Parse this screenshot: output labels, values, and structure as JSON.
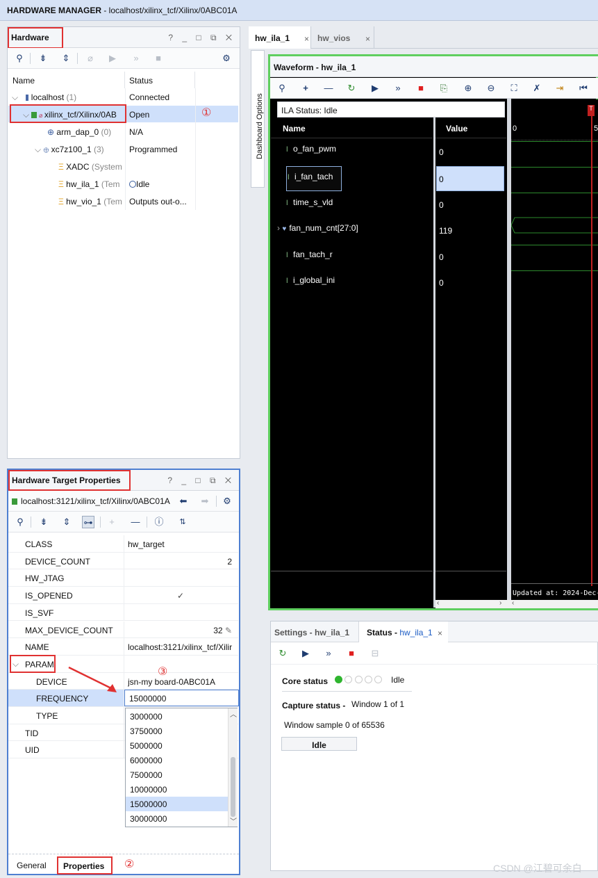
{
  "titlebar": {
    "app": "HARDWARE MANAGER",
    "path": " - localhost/xilinx_tcf/Xilinx/0ABC01A"
  },
  "hardware": {
    "title": "Hardware",
    "window_controls": "? _ □ ⧉ ✕",
    "columns": [
      "Name",
      "Status"
    ],
    "rows": [
      {
        "name": "localhost",
        "count": "(1)",
        "status": "Connected"
      },
      {
        "name": "xilinx_tcf/Xilinx/0AB",
        "count": "",
        "status": "Open"
      },
      {
        "name": "arm_dap_0",
        "count": "(0)",
        "status": "N/A"
      },
      {
        "name": "xc7z100_1",
        "count": "(3)",
        "status": "Programmed"
      },
      {
        "name": "XADC",
        "count": "(System",
        "status": ""
      },
      {
        "name": "hw_ila_1",
        "count": "(Tem",
        "status": "Idle"
      },
      {
        "name": "hw_vio_1",
        "count": "(Tem",
        "status": "Outputs out-o..."
      }
    ]
  },
  "annotations": {
    "one": "①",
    "two": "②",
    "three": "③"
  },
  "props": {
    "title": "Hardware Target Properties",
    "window_controls": "? _ □ ⧉ ✕",
    "target": "localhost:3121/xilinx_tcf/Xilinx/0ABC01A",
    "rows": [
      {
        "key": "CLASS",
        "value": "hw_target"
      },
      {
        "key": "DEVICE_COUNT",
        "value": "2"
      },
      {
        "key": "HW_JTAG",
        "value": ""
      },
      {
        "key": "IS_OPENED",
        "value": "✓"
      },
      {
        "key": "IS_SVF",
        "value": ""
      },
      {
        "key": "MAX_DEVICE_COUNT",
        "value": "32"
      },
      {
        "key": "NAME",
        "value": "localhost:3121/xilinx_tcf/Xilir"
      },
      {
        "key": "PARAM",
        "value": ""
      },
      {
        "key": "DEVICE",
        "value": "jsn-my board-0ABC01A"
      },
      {
        "key": "FREQUENCY",
        "value": "15000000"
      },
      {
        "key": "TYPE",
        "value": ""
      },
      {
        "key": "TID",
        "value": ""
      },
      {
        "key": "UID",
        "value": ""
      }
    ],
    "dropdown_options": [
      "3000000",
      "3750000",
      "5000000",
      "6000000",
      "7500000",
      "10000000",
      "15000000",
      "30000000"
    ],
    "dropdown_selected": "15000000",
    "tabs": [
      "General",
      "Properties"
    ]
  },
  "tabs": {
    "t1": "hw_ila_1",
    "t2": "hw_vios",
    "close": "×"
  },
  "dashboard_options": "Dashboard Options",
  "waveform": {
    "title": "Waveform - hw_ila_1",
    "ila_status": "ILA Status: Idle",
    "columns": [
      "Name",
      "Value"
    ],
    "signals": [
      {
        "name": "o_fan_pwm",
        "value": "0"
      },
      {
        "name": "i_fan_tach",
        "value": "0"
      },
      {
        "name": "time_s_vld",
        "value": "0"
      },
      {
        "name": "fan_num_cnt[27:0]",
        "value": "119"
      },
      {
        "name": "fan_tach_r",
        "value": "0"
      },
      {
        "name": "i_global_ini",
        "value": "0"
      }
    ],
    "time_labels": [
      "0",
      "5"
    ],
    "updated_at": "Updated at: 2024-Dec-",
    "cursor_label": "T"
  },
  "status_panel": {
    "tab_settings": "Settings - hw_ila_1",
    "tab_status_prefix": "Status - ",
    "tab_status_name": "hw_ila_1",
    "core_status_label": "Core status",
    "core_status_value": "Idle",
    "capture_status_label": "Capture status -",
    "capture_status_value": "Window 1 of 1",
    "window_sample": "Window sample 0 of 65536",
    "button": "Idle"
  },
  "watermark": "CSDN @江碧可余白",
  "colors": {
    "accent": "#1f3c70",
    "annotation": "#e03131",
    "selection": "#cfe0fb",
    "panel_focus": "#4e7fd1",
    "waveform_focus": "#5fcf5f"
  }
}
